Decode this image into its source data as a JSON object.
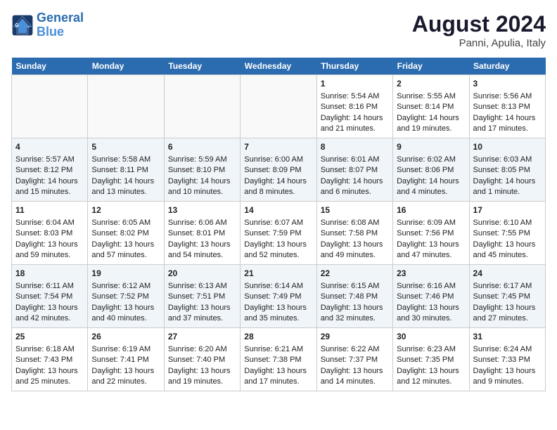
{
  "header": {
    "logo_line1": "General",
    "logo_line2": "Blue",
    "month_year": "August 2024",
    "location": "Panni, Apulia, Italy"
  },
  "days_of_week": [
    "Sunday",
    "Monday",
    "Tuesday",
    "Wednesday",
    "Thursday",
    "Friday",
    "Saturday"
  ],
  "weeks": [
    [
      {
        "day": "",
        "empty": true
      },
      {
        "day": "",
        "empty": true
      },
      {
        "day": "",
        "empty": true
      },
      {
        "day": "",
        "empty": true
      },
      {
        "day": "1",
        "sunrise": "5:54 AM",
        "sunset": "8:16 PM",
        "daylight": "14 hours and 21 minutes."
      },
      {
        "day": "2",
        "sunrise": "5:55 AM",
        "sunset": "8:14 PM",
        "daylight": "14 hours and 19 minutes."
      },
      {
        "day": "3",
        "sunrise": "5:56 AM",
        "sunset": "8:13 PM",
        "daylight": "14 hours and 17 minutes."
      }
    ],
    [
      {
        "day": "4",
        "sunrise": "5:57 AM",
        "sunset": "8:12 PM",
        "daylight": "14 hours and 15 minutes."
      },
      {
        "day": "5",
        "sunrise": "5:58 AM",
        "sunset": "8:11 PM",
        "daylight": "14 hours and 13 minutes."
      },
      {
        "day": "6",
        "sunrise": "5:59 AM",
        "sunset": "8:10 PM",
        "daylight": "14 hours and 10 minutes."
      },
      {
        "day": "7",
        "sunrise": "6:00 AM",
        "sunset": "8:09 PM",
        "daylight": "14 hours and 8 minutes."
      },
      {
        "day": "8",
        "sunrise": "6:01 AM",
        "sunset": "8:07 PM",
        "daylight": "14 hours and 6 minutes."
      },
      {
        "day": "9",
        "sunrise": "6:02 AM",
        "sunset": "8:06 PM",
        "daylight": "14 hours and 4 minutes."
      },
      {
        "day": "10",
        "sunrise": "6:03 AM",
        "sunset": "8:05 PM",
        "daylight": "14 hours and 1 minute."
      }
    ],
    [
      {
        "day": "11",
        "sunrise": "6:04 AM",
        "sunset": "8:03 PM",
        "daylight": "13 hours and 59 minutes."
      },
      {
        "day": "12",
        "sunrise": "6:05 AM",
        "sunset": "8:02 PM",
        "daylight": "13 hours and 57 minutes."
      },
      {
        "day": "13",
        "sunrise": "6:06 AM",
        "sunset": "8:01 PM",
        "daylight": "13 hours and 54 minutes."
      },
      {
        "day": "14",
        "sunrise": "6:07 AM",
        "sunset": "7:59 PM",
        "daylight": "13 hours and 52 minutes."
      },
      {
        "day": "15",
        "sunrise": "6:08 AM",
        "sunset": "7:58 PM",
        "daylight": "13 hours and 49 minutes."
      },
      {
        "day": "16",
        "sunrise": "6:09 AM",
        "sunset": "7:56 PM",
        "daylight": "13 hours and 47 minutes."
      },
      {
        "day": "17",
        "sunrise": "6:10 AM",
        "sunset": "7:55 PM",
        "daylight": "13 hours and 45 minutes."
      }
    ],
    [
      {
        "day": "18",
        "sunrise": "6:11 AM",
        "sunset": "7:54 PM",
        "daylight": "13 hours and 42 minutes."
      },
      {
        "day": "19",
        "sunrise": "6:12 AM",
        "sunset": "7:52 PM",
        "daylight": "13 hours and 40 minutes."
      },
      {
        "day": "20",
        "sunrise": "6:13 AM",
        "sunset": "7:51 PM",
        "daylight": "13 hours and 37 minutes."
      },
      {
        "day": "21",
        "sunrise": "6:14 AM",
        "sunset": "7:49 PM",
        "daylight": "13 hours and 35 minutes."
      },
      {
        "day": "22",
        "sunrise": "6:15 AM",
        "sunset": "7:48 PM",
        "daylight": "13 hours and 32 minutes."
      },
      {
        "day": "23",
        "sunrise": "6:16 AM",
        "sunset": "7:46 PM",
        "daylight": "13 hours and 30 minutes."
      },
      {
        "day": "24",
        "sunrise": "6:17 AM",
        "sunset": "7:45 PM",
        "daylight": "13 hours and 27 minutes."
      }
    ],
    [
      {
        "day": "25",
        "sunrise": "6:18 AM",
        "sunset": "7:43 PM",
        "daylight": "13 hours and 25 minutes."
      },
      {
        "day": "26",
        "sunrise": "6:19 AM",
        "sunset": "7:41 PM",
        "daylight": "13 hours and 22 minutes."
      },
      {
        "day": "27",
        "sunrise": "6:20 AM",
        "sunset": "7:40 PM",
        "daylight": "13 hours and 19 minutes."
      },
      {
        "day": "28",
        "sunrise": "6:21 AM",
        "sunset": "7:38 PM",
        "daylight": "13 hours and 17 minutes."
      },
      {
        "day": "29",
        "sunrise": "6:22 AM",
        "sunset": "7:37 PM",
        "daylight": "13 hours and 14 minutes."
      },
      {
        "day": "30",
        "sunrise": "6:23 AM",
        "sunset": "7:35 PM",
        "daylight": "13 hours and 12 minutes."
      },
      {
        "day": "31",
        "sunrise": "6:24 AM",
        "sunset": "7:33 PM",
        "daylight": "13 hours and 9 minutes."
      }
    ]
  ]
}
